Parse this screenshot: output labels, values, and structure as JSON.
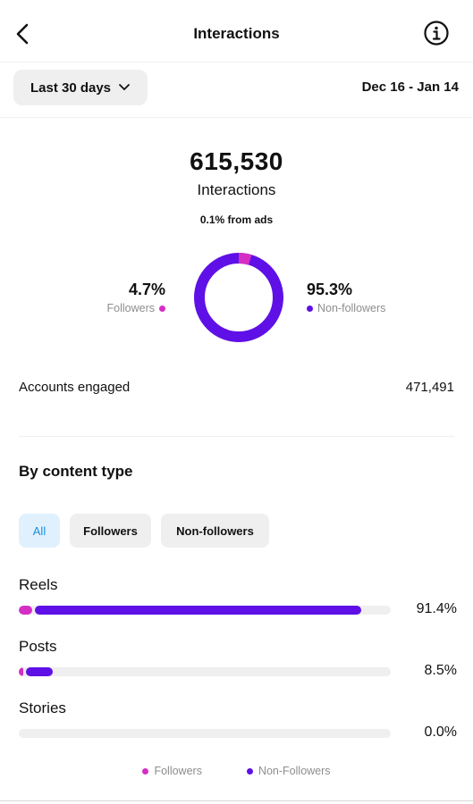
{
  "header": {
    "title": "Interactions",
    "back_icon": "chevron-left-icon",
    "info_icon": "info-icon"
  },
  "range": {
    "selected": "Last 30 days",
    "dates": "Dec 16 - Jan 14"
  },
  "summary": {
    "total": "615,530",
    "label": "Interactions",
    "ads_note": "0.1% from ads",
    "followers_pct": "4.7%",
    "followers_label": "Followers",
    "nonfollowers_pct": "95.3%",
    "nonfollowers_label": "Non-followers",
    "followers_fraction": 0.047
  },
  "accounts": {
    "label": "Accounts engaged",
    "value": "471,491"
  },
  "content": {
    "title": "By content type",
    "chips": [
      "All",
      "Followers",
      "Non-followers"
    ],
    "rows": [
      {
        "label": "Reels",
        "pct": "91.4%",
        "followers_fraction": 0.036,
        "nonfollowers_fraction": 0.878
      },
      {
        "label": "Posts",
        "pct": "8.5%",
        "followers_fraction": 0.012,
        "nonfollowers_fraction": 0.073
      },
      {
        "label": "Stories",
        "pct": "0.0%",
        "followers_fraction": 0,
        "nonfollowers_fraction": 0
      }
    ]
  },
  "legend": {
    "followers": "Followers",
    "nonfollowers": "Non-Followers"
  },
  "colors": {
    "followers": "#d42ec4",
    "nonfollowers": "#5f10e6"
  }
}
